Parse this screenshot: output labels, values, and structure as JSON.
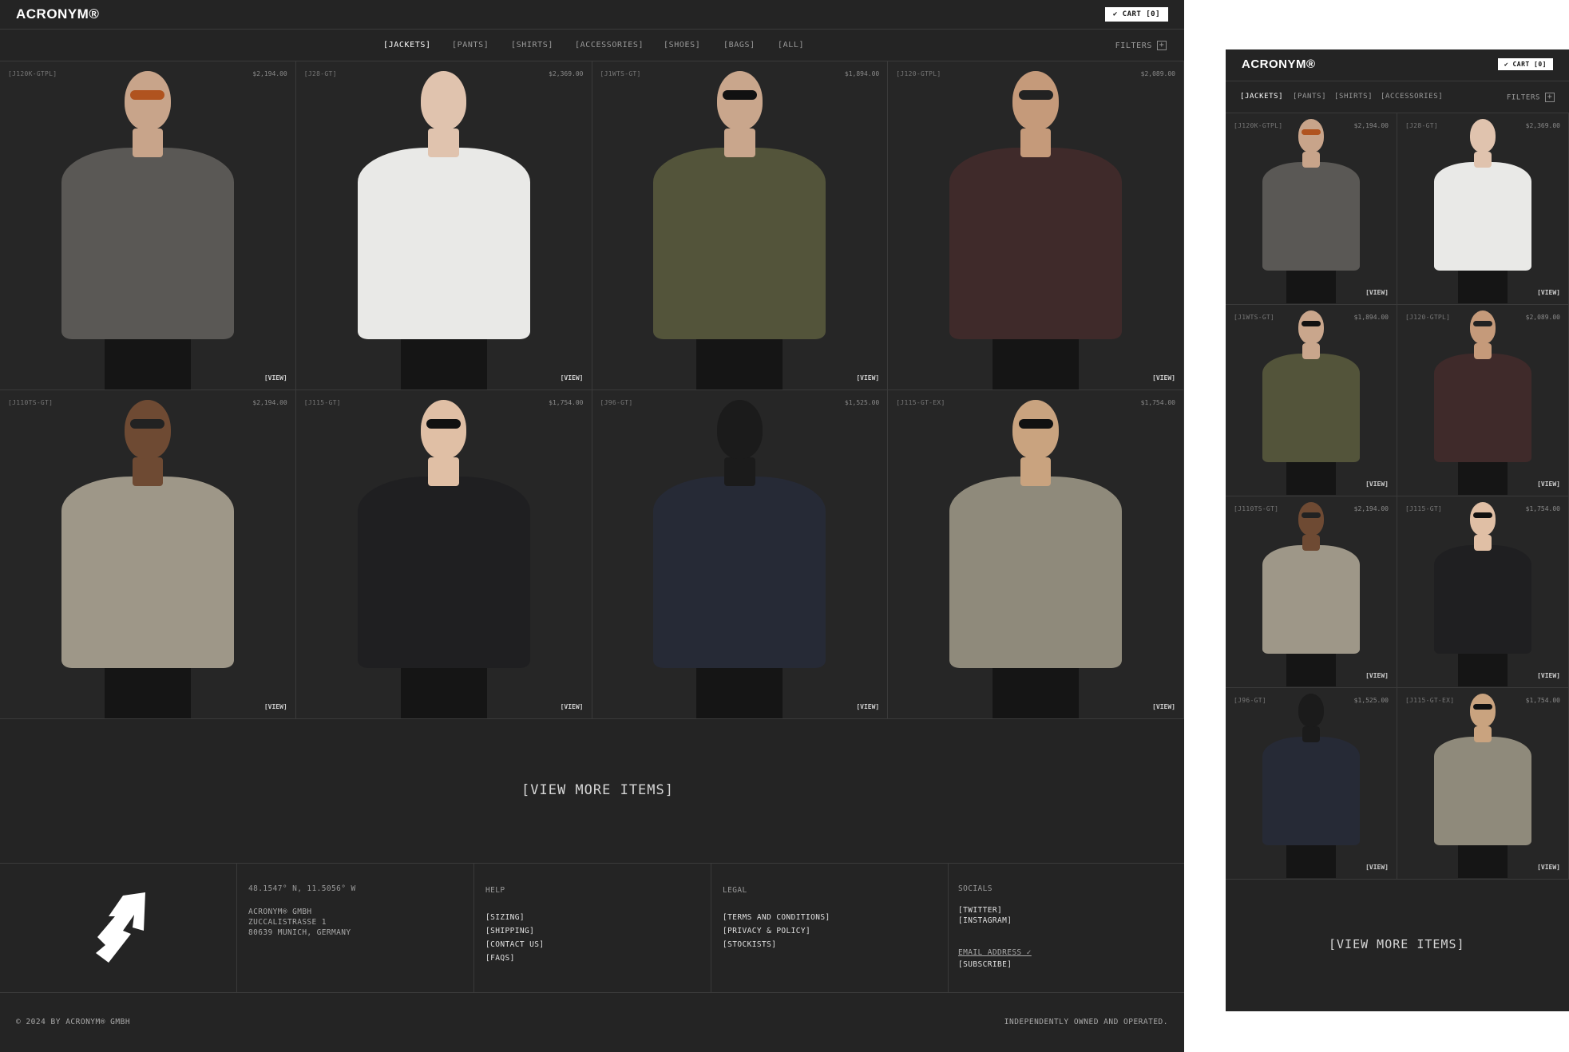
{
  "brand": {
    "logo": "ACRONYM®",
    "cart_label": "✔ CART [0]",
    "footer_mark": "A"
  },
  "nav": {
    "categories": [
      "[JACKETS]",
      "[PANTS]",
      "[SHIRTS]",
      "[ACCESSORIES]",
      "[SHOES]",
      "[BAGS]",
      "[ALL]"
    ],
    "filters_label": "FILTERS",
    "filters_icon": "plus-box-icon"
  },
  "products": [
    {
      "code": "[J120K-GTPL]",
      "price": "$2,194.00",
      "view": "[VIEW]",
      "jacket": "#5a5855",
      "head": "#c8a48a",
      "glasses": "#b0531f"
    },
    {
      "code": "[J28-GT]",
      "price": "$2,369.00",
      "view": "[VIEW]",
      "jacket": "#e9e9e7",
      "head": "#e0c3ae",
      "glasses": "none"
    },
    {
      "code": "[J1WTS-GT]",
      "price": "$1,894.00",
      "view": "[VIEW]",
      "jacket": "#53543a",
      "head": "#c9a68c",
      "glasses": "#111111"
    },
    {
      "code": "[J120-GTPL]",
      "price": "$2,089.00",
      "view": "[VIEW]",
      "jacket": "#3f2a2a",
      "head": "#c59a7a",
      "glasses": "#222222"
    },
    {
      "code": "[J110TS-GT]",
      "price": "$2,194.00",
      "view": "[VIEW]",
      "jacket": "#9e9788",
      "head": "#6e4a33",
      "glasses": "#222222"
    },
    {
      "code": "[J115-GT]",
      "price": "$1,754.00",
      "view": "[VIEW]",
      "jacket": "#1f1f21",
      "head": "#e0bfa5",
      "glasses": "#111111"
    },
    {
      "code": "[J96-GT]",
      "price": "$1,525.00",
      "view": "[VIEW]",
      "jacket": "#262a36",
      "head": "#1b1b1b",
      "glasses": "none"
    },
    {
      "code": "[J115-GT-EX]",
      "price": "$1,754.00",
      "view": "[VIEW]",
      "jacket": "#8f8a7b",
      "head": "#c9a37f",
      "glasses": "#111111"
    }
  ],
  "more_label": "[VIEW MORE ITEMS]",
  "footer": {
    "coords": "48.1547° N, 11.5056° W",
    "address": [
      "ACRONYM® GMBH",
      "ZUCCALISTRASSE 1",
      "80639 MUNICH, GERMANY"
    ],
    "help": {
      "title": "HELP",
      "links": [
        "[SIZING]",
        "[SHIPPING]",
        "[CONTACT US]",
        "[FAQS]"
      ]
    },
    "legal": {
      "title": "LEGAL",
      "links": [
        "[TERMS AND CONDITIONS]",
        "[PRIVACY & POLICY]",
        "[STOCKISTS]"
      ]
    },
    "socials": {
      "title": "SOCIALS",
      "links": [
        "[TWITTER]",
        "[INSTAGRAM]"
      ],
      "email_label": "EMAIL ADDRESS ✓",
      "subscribe_label": "[SUBSCRIBE]"
    },
    "copyright": "© 2024 BY ACRONYM® GMBH",
    "tagline": "INDEPENDENTLY OWNED AND OPERATED."
  },
  "mobile": {
    "categories": [
      "[JACKETS]",
      "[PANTS]",
      "[SHIRTS]",
      "[ACCESSORIES]"
    ],
    "product_codes": [
      "[J120K-GTPL]",
      "[J28-GT]",
      "[J1WTS-GT]",
      "[J120-GTPL]",
      "[J110TS-GT]",
      "[J115-GT]",
      "[J96-GT]",
      "[J115-GT-EX]"
    ]
  }
}
